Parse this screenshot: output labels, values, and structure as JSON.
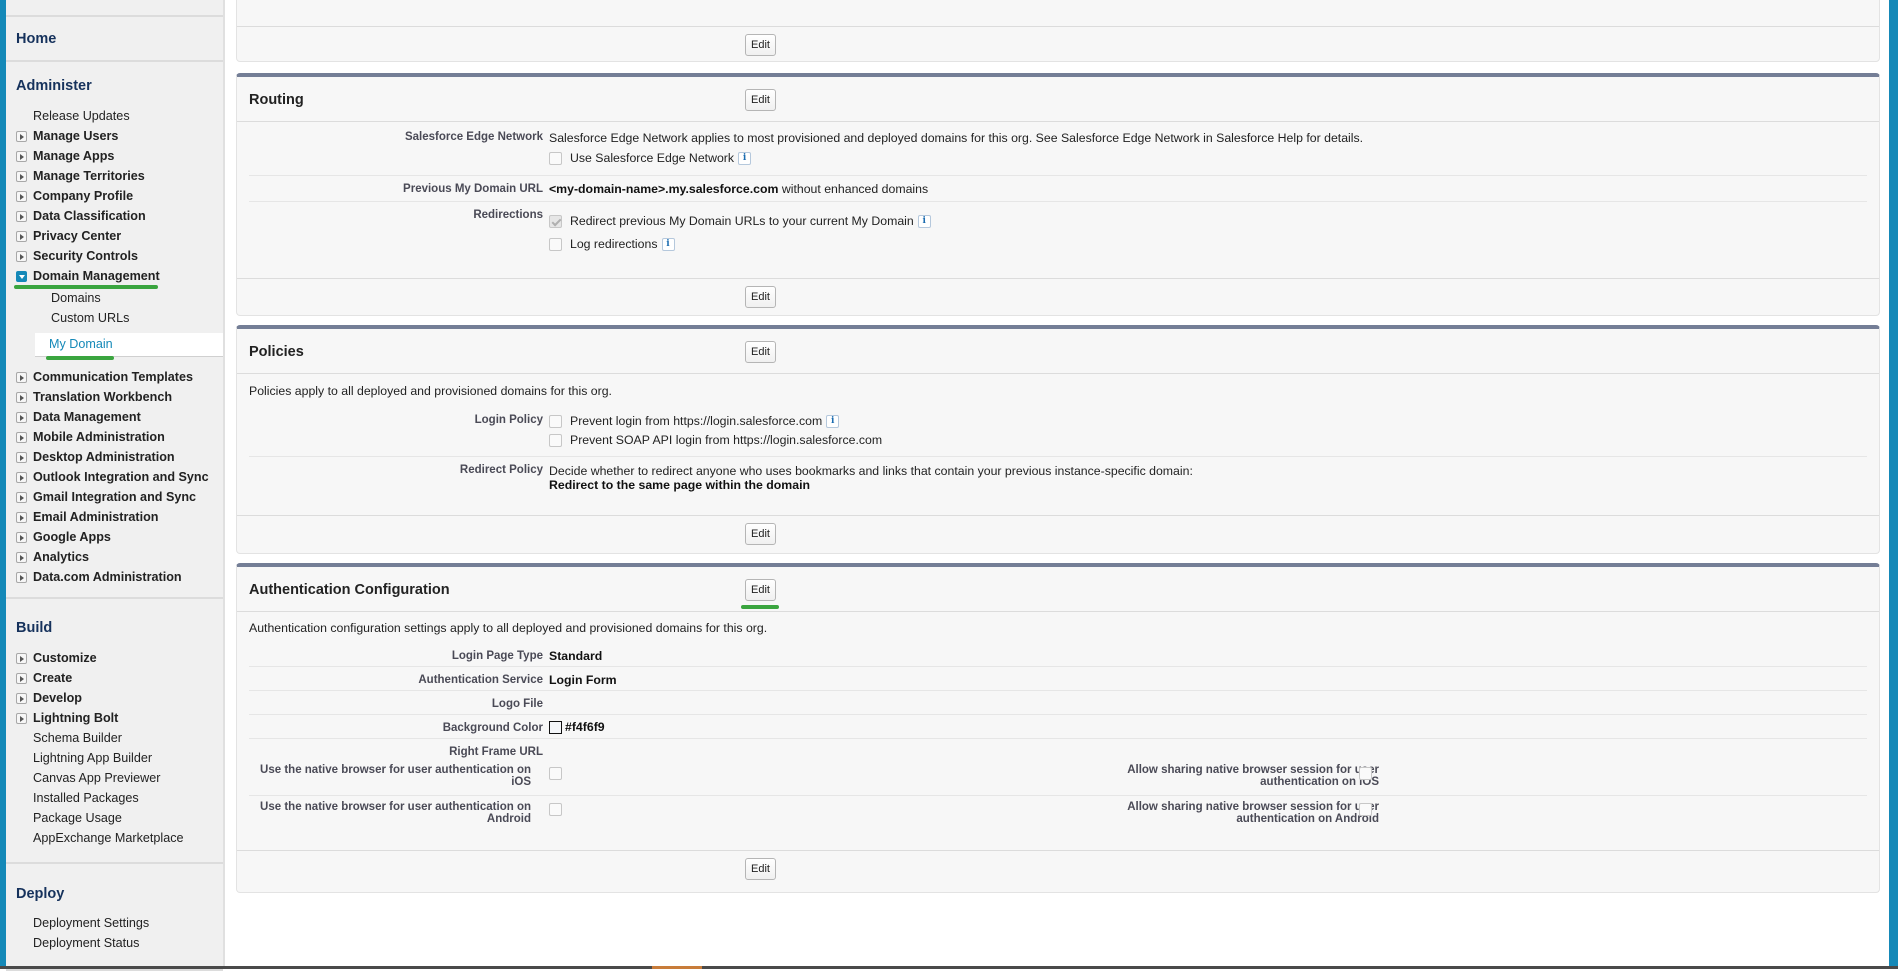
{
  "sidebar": {
    "home": "Home",
    "administer": {
      "heading": "Administer",
      "items": [
        {
          "label": "Release Updates",
          "toggle": false
        },
        {
          "label": "Manage Users",
          "toggle": true
        },
        {
          "label": "Manage Apps",
          "toggle": true
        },
        {
          "label": "Manage Territories",
          "toggle": true
        },
        {
          "label": "Company Profile",
          "toggle": true
        },
        {
          "label": "Data Classification",
          "toggle": true
        },
        {
          "label": "Privacy Center",
          "toggle": true
        },
        {
          "label": "Security Controls",
          "toggle": true
        },
        {
          "label": "Domain Management",
          "toggle": true,
          "expanded": true
        }
      ],
      "domain_sub": [
        "Domains",
        "Custom URLs"
      ],
      "active_item": "My Domain",
      "items_after": [
        "Communication Templates",
        "Translation Workbench",
        "Data Management",
        "Mobile Administration",
        "Desktop Administration",
        "Outlook Integration and Sync",
        "Gmail Integration and Sync",
        "Email Administration",
        "Google Apps",
        "Analytics",
        "Data.com Administration"
      ]
    },
    "build": {
      "heading": "Build",
      "toggle_items": [
        "Customize",
        "Create",
        "Develop",
        "Lightning Bolt"
      ],
      "plain_items": [
        "Schema Builder",
        "Lightning App Builder",
        "Canvas App Previewer",
        "Installed Packages",
        "Package Usage",
        "AppExchange Marketplace"
      ]
    },
    "deploy": {
      "heading": "Deploy",
      "items": [
        "Deployment Settings",
        "Deployment Status"
      ]
    }
  },
  "edit_label": "Edit",
  "routing": {
    "title": "Routing",
    "edge_label": "Salesforce Edge Network",
    "edge_text": "Salesforce Edge Network applies to most provisioned and deployed domains for this org. See Salesforce Edge Network in Salesforce Help for details.",
    "edge_checkbox": "Use Salesforce Edge Network",
    "edge_checked": false,
    "prev_label": "Previous My Domain URL",
    "prev_value_bold": "<my-domain-name>.my.salesforce.com",
    "prev_value_rest": " without enhanced domains",
    "redir_label": "Redirections",
    "redir_checkbox": "Redirect previous My Domain URLs to your current My Domain",
    "redir_checked": true,
    "log_checkbox": "Log redirections",
    "log_checked": false
  },
  "policies": {
    "title": "Policies",
    "desc": "Policies apply to all deployed and provisioned domains for this org.",
    "login_label": "Login Policy",
    "login_opt1": "Prevent login from https://login.salesforce.com",
    "login_opt2": "Prevent SOAP API login from https://login.salesforce.com",
    "redirect_label": "Redirect Policy",
    "redirect_text": "Decide whether to redirect anyone who uses bookmarks and links that contain your previous instance-specific domain:",
    "redirect_value": "Redirect to the same page within the domain"
  },
  "auth": {
    "title": "Authentication Configuration",
    "desc": "Authentication configuration settings apply to all deployed and provisioned domains for this org.",
    "login_page_type_label": "Login Page Type",
    "login_page_type": "Standard",
    "auth_service_label": "Authentication Service",
    "auth_service": "Login Form",
    "logo_file_label": "Logo File",
    "bg_color_label": "Background Color",
    "bg_color": "#f4f6f9",
    "right_frame_label": "Right Frame URL",
    "native_ios_label_1": "Use the native browser for user authentication on",
    "native_ios_label_2": "iOS",
    "native_android_label_1": "Use the native browser for user authentication on",
    "native_android_label_2": "Android",
    "share_ios_label_1": "Allow sharing native browser session for user",
    "share_ios_label_2": "authentication on iOS",
    "share_android_label_1": "Allow sharing native browser session for user",
    "share_android_label_2": "authentication on Android"
  },
  "colors": {
    "accent": "#1589b8",
    "highlight": "#3aa53f",
    "panel_bar": "#747e96"
  }
}
